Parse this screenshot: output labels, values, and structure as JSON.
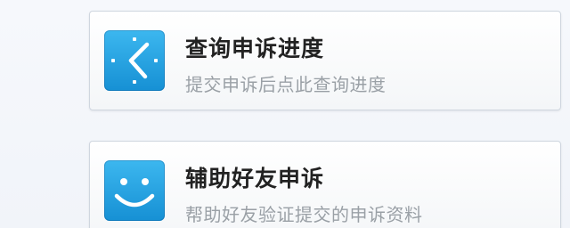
{
  "items": [
    {
      "title": "查询申诉进度",
      "subtitle": "提交申诉后点此查询进度",
      "icon": "clock-icon",
      "icon_color": "#1f9be0"
    },
    {
      "title": "辅助好友申诉",
      "subtitle": "帮助好友验证提交的申诉资料",
      "icon": "smiley-icon",
      "icon_color": "#1f9be0"
    }
  ]
}
